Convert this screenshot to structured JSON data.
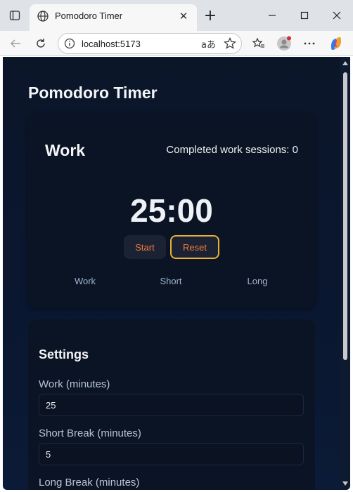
{
  "browser": {
    "tab_title": "Pomodoro Timer",
    "url": "localhost:5173",
    "read_aloud_glyph": "aあ"
  },
  "app": {
    "title": "Pomodoro Timer"
  },
  "timer": {
    "mode": "Work",
    "sessions_label": "Completed work sessions: 0",
    "time": "25:00",
    "start_label": "Start",
    "reset_label": "Reset",
    "modes": [
      "Work",
      "Short",
      "Long"
    ]
  },
  "settings": {
    "title": "Settings",
    "fields": [
      {
        "label": "Work (minutes)",
        "value": "25"
      },
      {
        "label": "Short Break (minutes)",
        "value": "5"
      },
      {
        "label": "Long Break (minutes)",
        "value": ""
      }
    ]
  },
  "colors": {
    "accent_orange": "#f07a3a",
    "reset_border": "#e8b233",
    "page_bg": "#0b1629"
  },
  "icons": [
    "sidebar-toggle-icon",
    "globe-icon",
    "close-icon",
    "plus-icon",
    "minimize-icon",
    "maximize-icon",
    "window-close-icon",
    "back-icon",
    "refresh-icon",
    "info-icon",
    "star-icon",
    "favorites-icon",
    "profile-icon",
    "more-icon",
    "copilot-icon"
  ]
}
